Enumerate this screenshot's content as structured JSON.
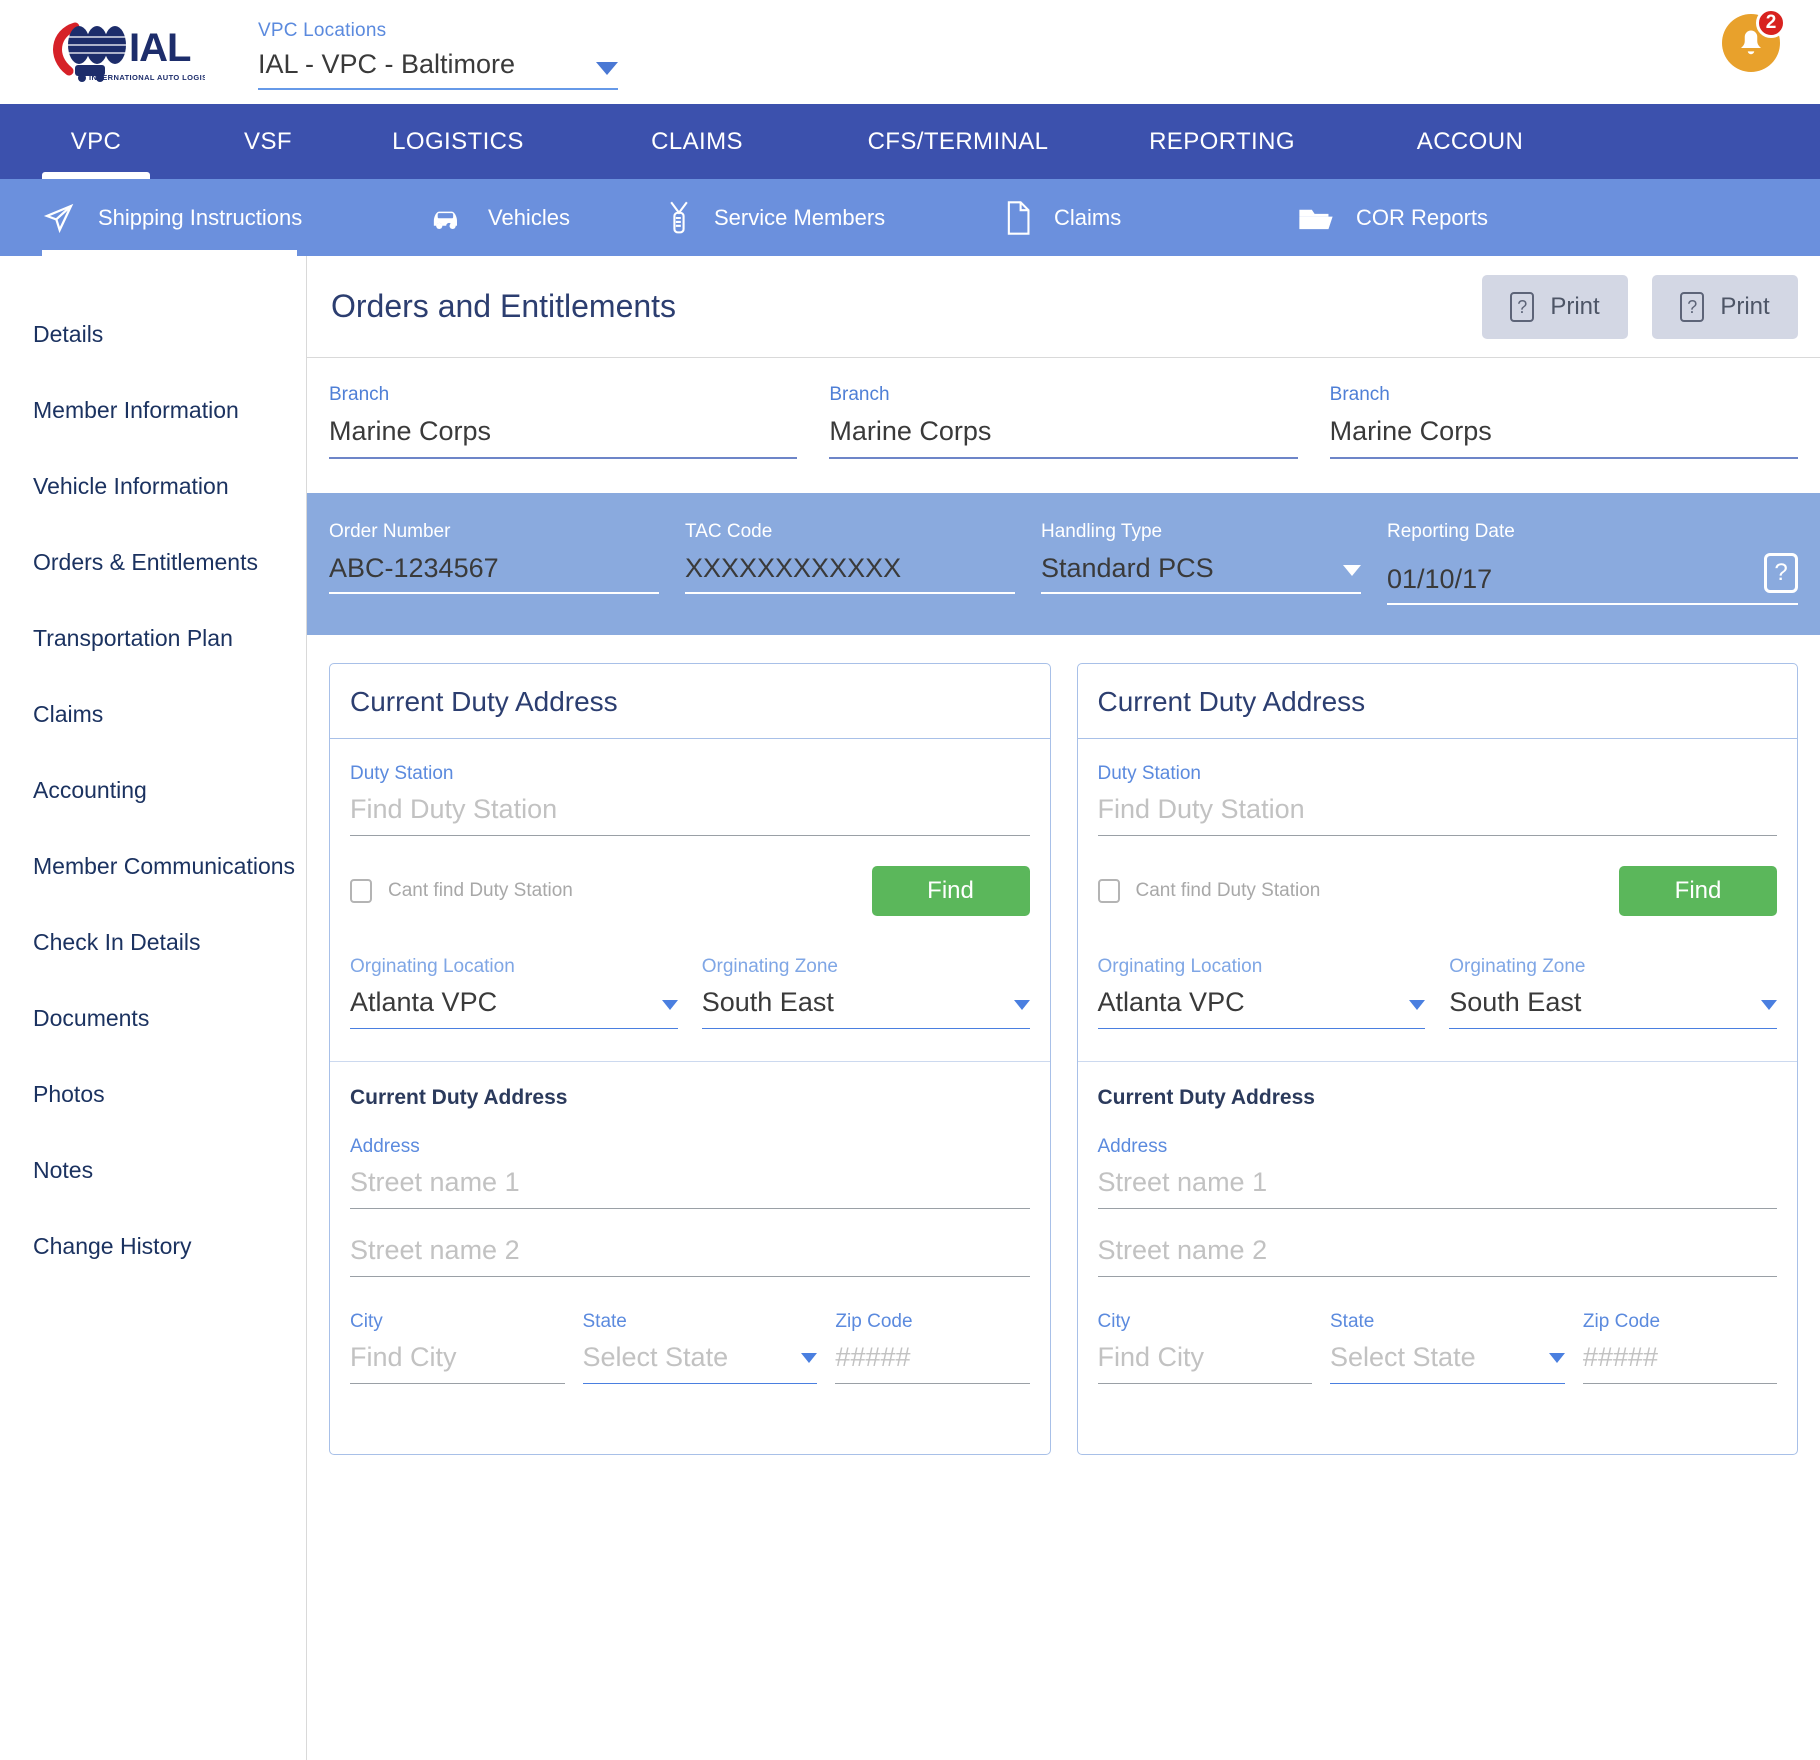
{
  "topbar": {
    "logo": {
      "brand": "IAL",
      "tagline": "INTERNATIONAL AUTO LOGISTICS",
      "icon": "globe-truck-logo"
    },
    "location_select": {
      "label": "VPC Locations",
      "value": "IAL - VPC - Baltimore",
      "icon": "chevron-down-icon"
    },
    "notifications": {
      "icon": "bell-icon",
      "count": "2",
      "badge_color": "#d8221f",
      "circle_color": "#e8a12c"
    }
  },
  "main_nav": {
    "active": "VPC",
    "accent": "#3c51ad",
    "items": [
      {
        "label": "VPC"
      },
      {
        "label": "VSF"
      },
      {
        "label": "LOGISTICS"
      },
      {
        "label": "CLAIMS"
      },
      {
        "label": "CFS/TERMINAL"
      },
      {
        "label": "REPORTING"
      },
      {
        "label": "ACCOUN"
      }
    ]
  },
  "sub_nav": {
    "active": "Shipping Instructions",
    "background": "#6b90dd",
    "items": [
      {
        "label": "Shipping Instructions",
        "icon": "paper-plane-icon"
      },
      {
        "label": "Vehicles",
        "icon": "car-icon"
      },
      {
        "label": "Service Members",
        "icon": "dog-tag-icon"
      },
      {
        "label": "Claims",
        "icon": "document-icon"
      },
      {
        "label": "COR Reports",
        "icon": "folder-open-icon"
      }
    ]
  },
  "sidebar": {
    "items": [
      {
        "label": "Details"
      },
      {
        "label": "Member Information"
      },
      {
        "label": "Vehicle Information"
      },
      {
        "label": "Orders & Entitlements"
      },
      {
        "label": "Transportation Plan"
      },
      {
        "label": "Claims"
      },
      {
        "label": "Accounting"
      },
      {
        "label": "Member Communications"
      },
      {
        "label": "Check In Details"
      },
      {
        "label": "Documents"
      },
      {
        "label": "Photos"
      },
      {
        "label": "Notes"
      },
      {
        "label": "Change History"
      }
    ]
  },
  "page": {
    "title": "Orders and Entitlements",
    "print_buttons": [
      {
        "label": "Print",
        "icon": "help-box-icon"
      },
      {
        "label": "Print",
        "icon": "help-box-icon"
      }
    ]
  },
  "branch_row": [
    {
      "label": "Branch",
      "value": "Marine Corps"
    },
    {
      "label": "Branch",
      "value": "Marine Corps"
    },
    {
      "label": "Branch",
      "value": "Marine Corps"
    }
  ],
  "order_band": {
    "background": "#8aaade",
    "order_number": {
      "label": "Order Number",
      "value": "ABC-1234567"
    },
    "tac_code": {
      "label": "TAC Code",
      "value": "XXXXXXXXXXXX"
    },
    "handling_type": {
      "label": "Handling Type",
      "value": "Standard PCS",
      "icon": "chevron-down-icon"
    },
    "reporting_date": {
      "label": "Reporting Date",
      "value": "01/10/17",
      "icon": "help-box-icon"
    }
  },
  "cards": [
    {
      "title": "Current Duty Address",
      "duty_station": {
        "label": "Duty Station",
        "placeholder": "Find Duty Station"
      },
      "cant_find": {
        "label": "Cant find Duty Station",
        "checked": false
      },
      "find_button": {
        "label": "Find",
        "color": "#5bb75b"
      },
      "originating_location": {
        "label": "Orginating Location",
        "value": "Atlanta VPC",
        "icon": "chevron-down-icon"
      },
      "originating_zone": {
        "label": "Orginating Zone",
        "value": "South East",
        "icon": "chevron-down-icon"
      },
      "address_section": {
        "heading": "Current Duty Address",
        "address_label": "Address",
        "street1_placeholder": "Street name 1",
        "street2_placeholder": "Street name 2",
        "city": {
          "label": "City",
          "placeholder": "Find City"
        },
        "state": {
          "label": "State",
          "placeholder": "Select State",
          "icon": "chevron-down-icon"
        },
        "zip": {
          "label": "Zip Code",
          "placeholder": "#####"
        }
      }
    },
    {
      "title": "Current Duty Address",
      "duty_station": {
        "label": "Duty Station",
        "placeholder": "Find Duty Station"
      },
      "cant_find": {
        "label": "Cant find Duty Station",
        "checked": false
      },
      "find_button": {
        "label": "Find",
        "color": "#5bb75b"
      },
      "originating_location": {
        "label": "Orginating Location",
        "value": "Atlanta VPC",
        "icon": "chevron-down-icon"
      },
      "originating_zone": {
        "label": "Orginating Zone",
        "value": "South East",
        "icon": "chevron-down-icon"
      },
      "address_section": {
        "heading": "Current Duty Address",
        "address_label": "Address",
        "street1_placeholder": "Street name 1",
        "street2_placeholder": "Street name 2",
        "city": {
          "label": "City",
          "placeholder": "Find City"
        },
        "state": {
          "label": "State",
          "placeholder": "Select State",
          "icon": "chevron-down-icon"
        },
        "zip": {
          "label": "Zip Code",
          "placeholder": "#####"
        }
      }
    }
  ]
}
